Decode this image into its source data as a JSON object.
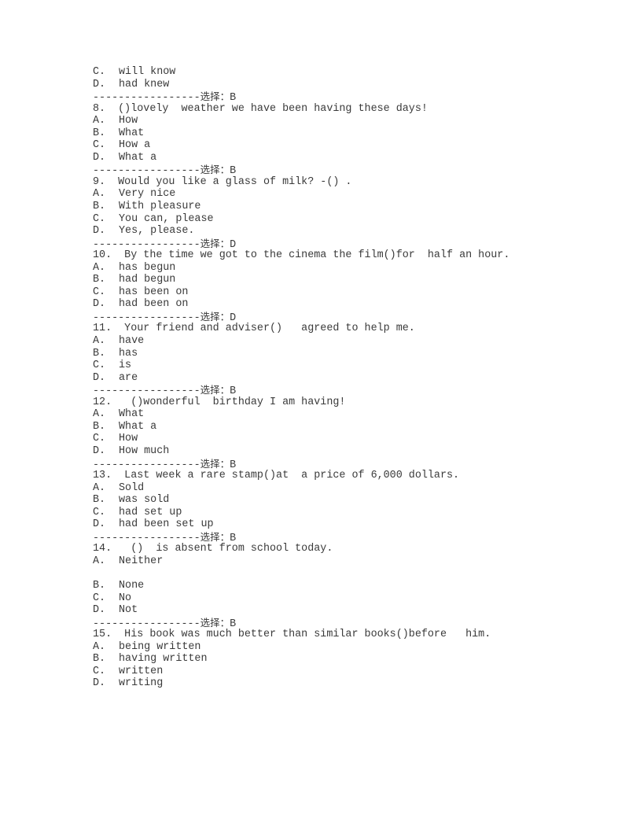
{
  "document": {
    "leading_fragment": {
      "options": [
        {
          "letter": "C.",
          "text": "will know"
        },
        {
          "letter": "D.",
          "text": "had knew"
        }
      ],
      "answer": {
        "dashes": "-----------------",
        "label": "选择：",
        "value": "B"
      }
    },
    "questions": [
      {
        "number": "8.",
        "text": "  ()lovely  weather we have been having these days!",
        "options": [
          {
            "letter": "A.",
            "text": "How"
          },
          {
            "letter": "B.",
            "text": "What"
          },
          {
            "letter": "C.",
            "text": "How a"
          },
          {
            "letter": "D.",
            "text": "What a"
          }
        ],
        "answer": {
          "dashes": "-----------------",
          "label": "选择：",
          "value": "B"
        }
      },
      {
        "number": "9.",
        "text": "  Would you like a glass of milk? -() .",
        "options": [
          {
            "letter": "A.",
            "text": "Very nice"
          },
          {
            "letter": "B.",
            "text": "With pleasure"
          },
          {
            "letter": "C.",
            "text": "You can, please"
          },
          {
            "letter": "D.",
            "text": "Yes, please."
          }
        ],
        "answer": {
          "dashes": "-----------------",
          "label": "选择：",
          "value": "D"
        }
      },
      {
        "number": "10.",
        "text": "  By the time we got to the cinema the film()for  half an hour.",
        "options": [
          {
            "letter": "A.",
            "text": "has begun"
          },
          {
            "letter": "B.",
            "text": "had begun"
          },
          {
            "letter": "C.",
            "text": "has been on"
          },
          {
            "letter": "D.",
            "text": "had been on"
          }
        ],
        "answer": {
          "dashes": "-----------------",
          "label": "选择：",
          "value": "D"
        }
      },
      {
        "number": "11.",
        "text": "  Your friend and adviser()   agreed to help me.",
        "options": [
          {
            "letter": "A.",
            "text": "have"
          },
          {
            "letter": "B.",
            "text": "has"
          },
          {
            "letter": "C.",
            "text": "is"
          },
          {
            "letter": "D.",
            "text": "are"
          }
        ],
        "answer": {
          "dashes": "-----------------",
          "label": "选择：",
          "value": "B"
        }
      },
      {
        "number": "12.",
        "text": "   ()wonderful  birthday I am having!",
        "options": [
          {
            "letter": "A.",
            "text": "What"
          },
          {
            "letter": "B.",
            "text": "What a"
          },
          {
            "letter": "C.",
            "text": "How"
          },
          {
            "letter": "D.",
            "text": "How much"
          }
        ],
        "answer": {
          "dashes": "-----------------",
          "label": "选择：",
          "value": "B"
        }
      },
      {
        "number": "13.",
        "text": "  Last week a rare stamp()at  a price of 6,000 dollars.",
        "options": [
          {
            "letter": "A.",
            "text": "Sold"
          },
          {
            "letter": "B.",
            "text": "was sold"
          },
          {
            "letter": "C.",
            "text": "had set up"
          },
          {
            "letter": "D.",
            "text": "had been set up"
          }
        ],
        "answer": {
          "dashes": "-----------------",
          "label": "选择：",
          "value": "B"
        }
      },
      {
        "number": "14.",
        "text": "   ()  is absent from school today.",
        "options": [
          {
            "letter": "A.",
            "text": "Neither",
            "blank_after": true
          },
          {
            "letter": "B.",
            "text": "None"
          },
          {
            "letter": "C.",
            "text": "No"
          },
          {
            "letter": "D.",
            "text": "Not"
          }
        ],
        "answer": {
          "dashes": "-----------------",
          "label": "选择：",
          "value": "B"
        }
      },
      {
        "number": "15.",
        "text": "  His book was much better than similar books()before   him.",
        "options": [
          {
            "letter": "A.",
            "text": "being written"
          },
          {
            "letter": "B.",
            "text": "having written"
          },
          {
            "letter": "C.",
            "text": "written"
          },
          {
            "letter": "D.",
            "text": "writing"
          }
        ],
        "answer": null
      }
    ]
  }
}
